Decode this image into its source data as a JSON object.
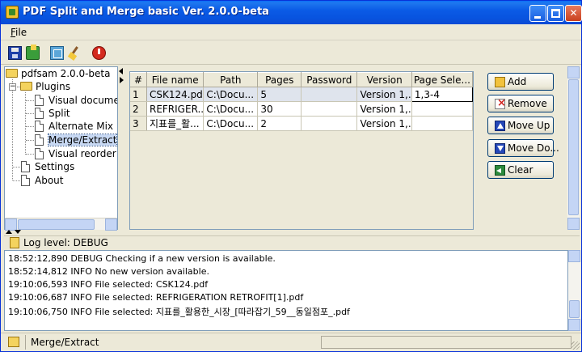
{
  "window": {
    "title": "PDF Split and Merge basic Ver. 2.0.0-beta"
  },
  "menu": {
    "file_label_u": "F",
    "file_label_rest": "ile"
  },
  "toolbar": {
    "icons": [
      "save-icon",
      "load-icon",
      "tab-icon",
      "clear-icon",
      "exit-icon"
    ]
  },
  "tree": {
    "root": "pdfsam 2.0.0-beta",
    "plugins": "Plugins",
    "items": [
      "Visual document composer",
      "Split",
      "Alternate Mix",
      "Merge/Extract",
      "Visual reorder"
    ],
    "settings": "Settings",
    "about": "About"
  },
  "table": {
    "headers": [
      "#",
      "File name",
      "Path",
      "Pages",
      "Password",
      "Version",
      "Page Sele..."
    ],
    "rows": [
      {
        "num": "1",
        "file": "CSK124.pdf",
        "path": "C:\\Docu...",
        "pages": "5",
        "password": "",
        "version": "Version 1,...",
        "selection": "1,3-4"
      },
      {
        "num": "2",
        "file": "REFRIGER...",
        "path": "C:\\Docu...",
        "pages": "30",
        "password": "",
        "version": "Version 1,...",
        "selection": ""
      },
      {
        "num": "3",
        "file": "지표를_활...",
        "path": "C:\\Docu...",
        "pages": "2",
        "password": "",
        "version": "Version 1,...",
        "selection": ""
      }
    ]
  },
  "buttons": {
    "add": "Add",
    "remove": "Remove",
    "move_up": "Move Up",
    "move_down": "Move Do...",
    "clear": "Clear"
  },
  "log": {
    "level_label": "Log level: DEBUG",
    "lines": [
      "18:52:12,890 DEBUG  Checking if a new version is available.",
      "18:52:14,812 INFO   No new version available.",
      "19:10:06,593 INFO   File selected: CSK124.pdf",
      "19:10:06,687 INFO   File selected: REFRIGERATION RETROFIT[1].pdf",
      "19:10:06,750 INFO   File selected: 지표를_활용한_시장_[따라잡기_59__동일점포_.pdf"
    ]
  },
  "status": {
    "text": "Merge/Extract"
  },
  "colors": {
    "titlebar": "#0854e0",
    "window_bg": "#ece9d8",
    "selection": "#c7d8f3"
  }
}
